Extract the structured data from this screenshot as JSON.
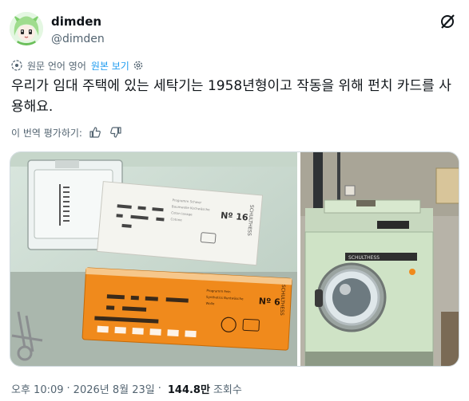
{
  "author": {
    "display_name": "dimden",
    "handle": "@dimden",
    "avatar_icon": "anime-avatar-icon"
  },
  "translate": {
    "label": "원문 언어 영어",
    "show_original": "원본 보기"
  },
  "tweet": {
    "text": "우리가 임대 주택에 있는 세탁기는 1958년형이고 작동을 위해 펀치 카드를 사용해요."
  },
  "rate": {
    "label": "이 번역 평가하기:"
  },
  "media": {
    "images": [
      {
        "name": "punch-cards-photo",
        "card_text_1": "Nº 16",
        "card_text_2": "Nº 6",
        "brand": "SCHULTHESS"
      },
      {
        "name": "washing-machine-photo",
        "brand": "SCHULTHESS"
      }
    ]
  },
  "meta": {
    "time": "오후 10:09",
    "sep": "·",
    "date": "2026년 8월 23일",
    "sep2": "·",
    "views": "144.8만",
    "views_label": "조회수"
  },
  "colors": {
    "accent": "#1d9bf0",
    "text": "#0f1419",
    "secondary": "#536471"
  }
}
